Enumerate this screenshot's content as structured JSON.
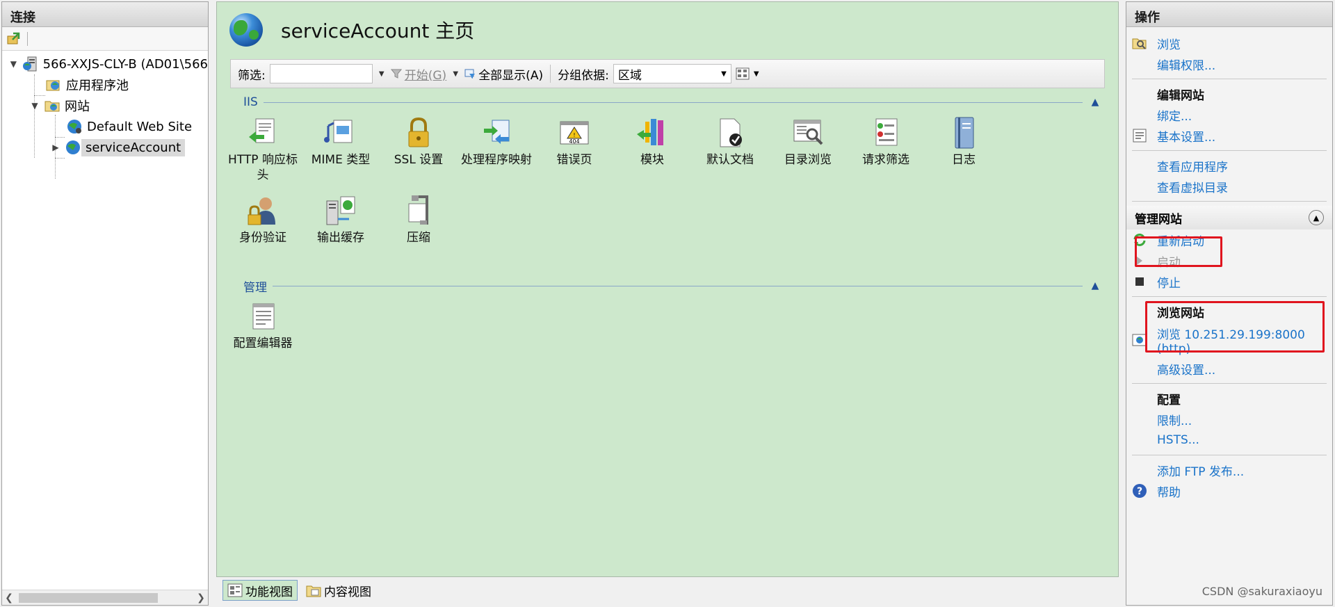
{
  "left": {
    "title": "连接",
    "tree": [
      {
        "label": "566-XXJS-CLY-B (AD01\\566"
      },
      {
        "label": "应用程序池"
      },
      {
        "label": "网站"
      },
      {
        "label": "Default Web Site"
      },
      {
        "label": "serviceAccount"
      }
    ]
  },
  "center": {
    "title": "serviceAccount 主页",
    "filter": {
      "label": "筛选:",
      "start_label": "开始(G)",
      "show_all_label": "全部显示(A)",
      "group_label": "分组依据:",
      "group_value": "区域"
    },
    "section_iis": "IIS",
    "section_manage": "管理",
    "features_iis": [
      {
        "label": "HTTP 响应标头"
      },
      {
        "label": "MIME 类型"
      },
      {
        "label": "SSL 设置"
      },
      {
        "label": "处理程序映射"
      },
      {
        "label": "错误页"
      },
      {
        "label": "模块"
      },
      {
        "label": "默认文档"
      },
      {
        "label": "目录浏览"
      },
      {
        "label": "请求筛选"
      },
      {
        "label": "日志"
      },
      {
        "label": "身份验证"
      },
      {
        "label": "输出缓存"
      },
      {
        "label": "压缩"
      }
    ],
    "features_manage": [
      {
        "label": "配置编辑器"
      }
    ],
    "tabs": {
      "features_view": "功能视图",
      "content_view": "内容视图"
    }
  },
  "right": {
    "title": "操作",
    "browse": "浏览",
    "edit_permissions": "编辑权限...",
    "edit_site_head": "编辑网站",
    "bindings": "绑定...",
    "basic_settings": "基本设置...",
    "view_apps": "查看应用程序",
    "view_vdirs": "查看虚拟目录",
    "manage_site_head": "管理网站",
    "restart": "重新启动",
    "start": "启动",
    "stop": "停止",
    "browse_site_head": "浏览网站",
    "browse_url": "浏览 10.251.29.199:8000",
    "browse_url_proto": "(http)",
    "advanced_settings": "高级设置...",
    "config_head": "配置",
    "limits": "限制...",
    "hsts": "HSTS...",
    "add_ftp": "添加 FTP 发布...",
    "help": "帮助"
  },
  "credit": "CSDN @sakuraxiaoyu",
  "colors": {
    "center_bg": "#cde8cc",
    "link": "#1a73c9",
    "highlight_box": "#e0141e"
  }
}
